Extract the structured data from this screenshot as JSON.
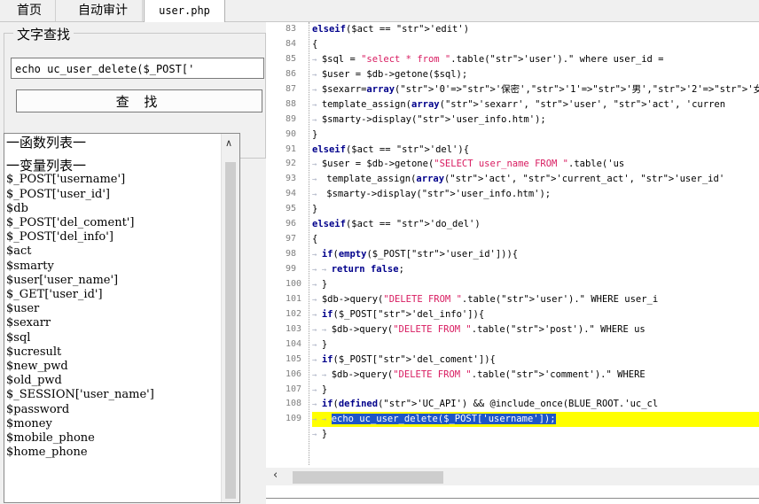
{
  "tabs": [
    "首页",
    "自动审计",
    "user.php"
  ],
  "search": {
    "group_title": "文字查找",
    "input_value": "echo uc_user_delete($_POST['",
    "button_label": "查 找"
  },
  "list": {
    "functions_header": "一函数列表一",
    "variables_header": "一变量列表一",
    "items": [
      "$_POST['username']",
      "$_POST['user_id']",
      "$db",
      "$_POST['del_coment']",
      "$_POST['del_info']",
      "$act",
      "$smarty",
      "$user['user_name']",
      "$_GET['user_id']",
      "$user",
      "$sexarr",
      "$sql",
      "$ucresult",
      "$new_pwd",
      "$old_pwd",
      "$_SESSION['user_name']",
      "$password",
      "$money",
      "$mobile_phone",
      "$home_phone"
    ]
  },
  "editor": {
    "line_numbers": [
      "83",
      "84",
      "85",
      "86",
      "87",
      "88",
      "89",
      "90",
      "91",
      "92",
      "93",
      "94",
      "95",
      "96",
      "97",
      "98",
      "99",
      "100",
      "101",
      "102",
      "103",
      "104",
      "105",
      "106",
      "107",
      "108",
      "109",
      ""
    ],
    "lines": [
      {
        "indent": "",
        "text": "elseif($act == 'edit')"
      },
      {
        "indent": "",
        "text": "{"
      },
      {
        "indent": "→ ",
        "text": "$sql = \"select * from \".table('user').\" where user_id ="
      },
      {
        "indent": "→ ",
        "text": "$user = $db->getone($sql);"
      },
      {
        "indent": "→ ",
        "text": "$sexarr=array('0'=>'保密','1'=>'男','2'=>'女');"
      },
      {
        "indent": "→ ",
        "text": "template_assign(array('sexarr', 'user', 'act', 'curren"
      },
      {
        "indent": "→ ",
        "text": "$smarty->display('user_info.htm');"
      },
      {
        "indent": "",
        "text": "}"
      },
      {
        "indent": "",
        "text": "elseif($act == 'del'){"
      },
      {
        "indent": "→ ",
        "text": "$user = $db->getone(\"SELECT user_name FROM \".table('us"
      },
      {
        "indent": "→  ",
        "text": "template_assign(array('act', 'current_act', 'user_id'"
      },
      {
        "indent": "→  ",
        "text": "$smarty->display('user_info.htm');"
      },
      {
        "indent": "",
        "text": "}"
      },
      {
        "indent": "",
        "text": "elseif($act == 'do_del')"
      },
      {
        "indent": "",
        "text": "{"
      },
      {
        "indent": "→ ",
        "text": "if(empty($_POST['user_id'])){"
      },
      {
        "indent": "→ → ",
        "text": "return false;"
      },
      {
        "indent": "→ ",
        "text": "}"
      },
      {
        "indent": "→ ",
        "text": "$db->query(\"DELETE FROM \".table('user').\" WHERE user_i"
      },
      {
        "indent": "→ ",
        "text": "if($_POST['del_info']){"
      },
      {
        "indent": "→ → ",
        "text": "$db->query(\"DELETE FROM \".table('post').\" WHERE us"
      },
      {
        "indent": "→ ",
        "text": "}"
      },
      {
        "indent": "→ ",
        "text": "if($_POST['del_coment']){"
      },
      {
        "indent": "→ → ",
        "text": "$db->query(\"DELETE FROM \".table('comment').\" WHERE"
      },
      {
        "indent": "→ ",
        "text": "}"
      },
      {
        "indent": "→ ",
        "text": "if(defined('UC_API') && @include_once(BLUE_ROOT.'uc_cl"
      },
      {
        "indent": "→ → ",
        "text": "echo uc_user_delete($_POST['username']);",
        "highlight": true
      },
      {
        "indent": "→ ",
        "text": "}"
      }
    ]
  },
  "colors": {
    "highlight": "#ffff00",
    "selection": "#1e56c8"
  }
}
